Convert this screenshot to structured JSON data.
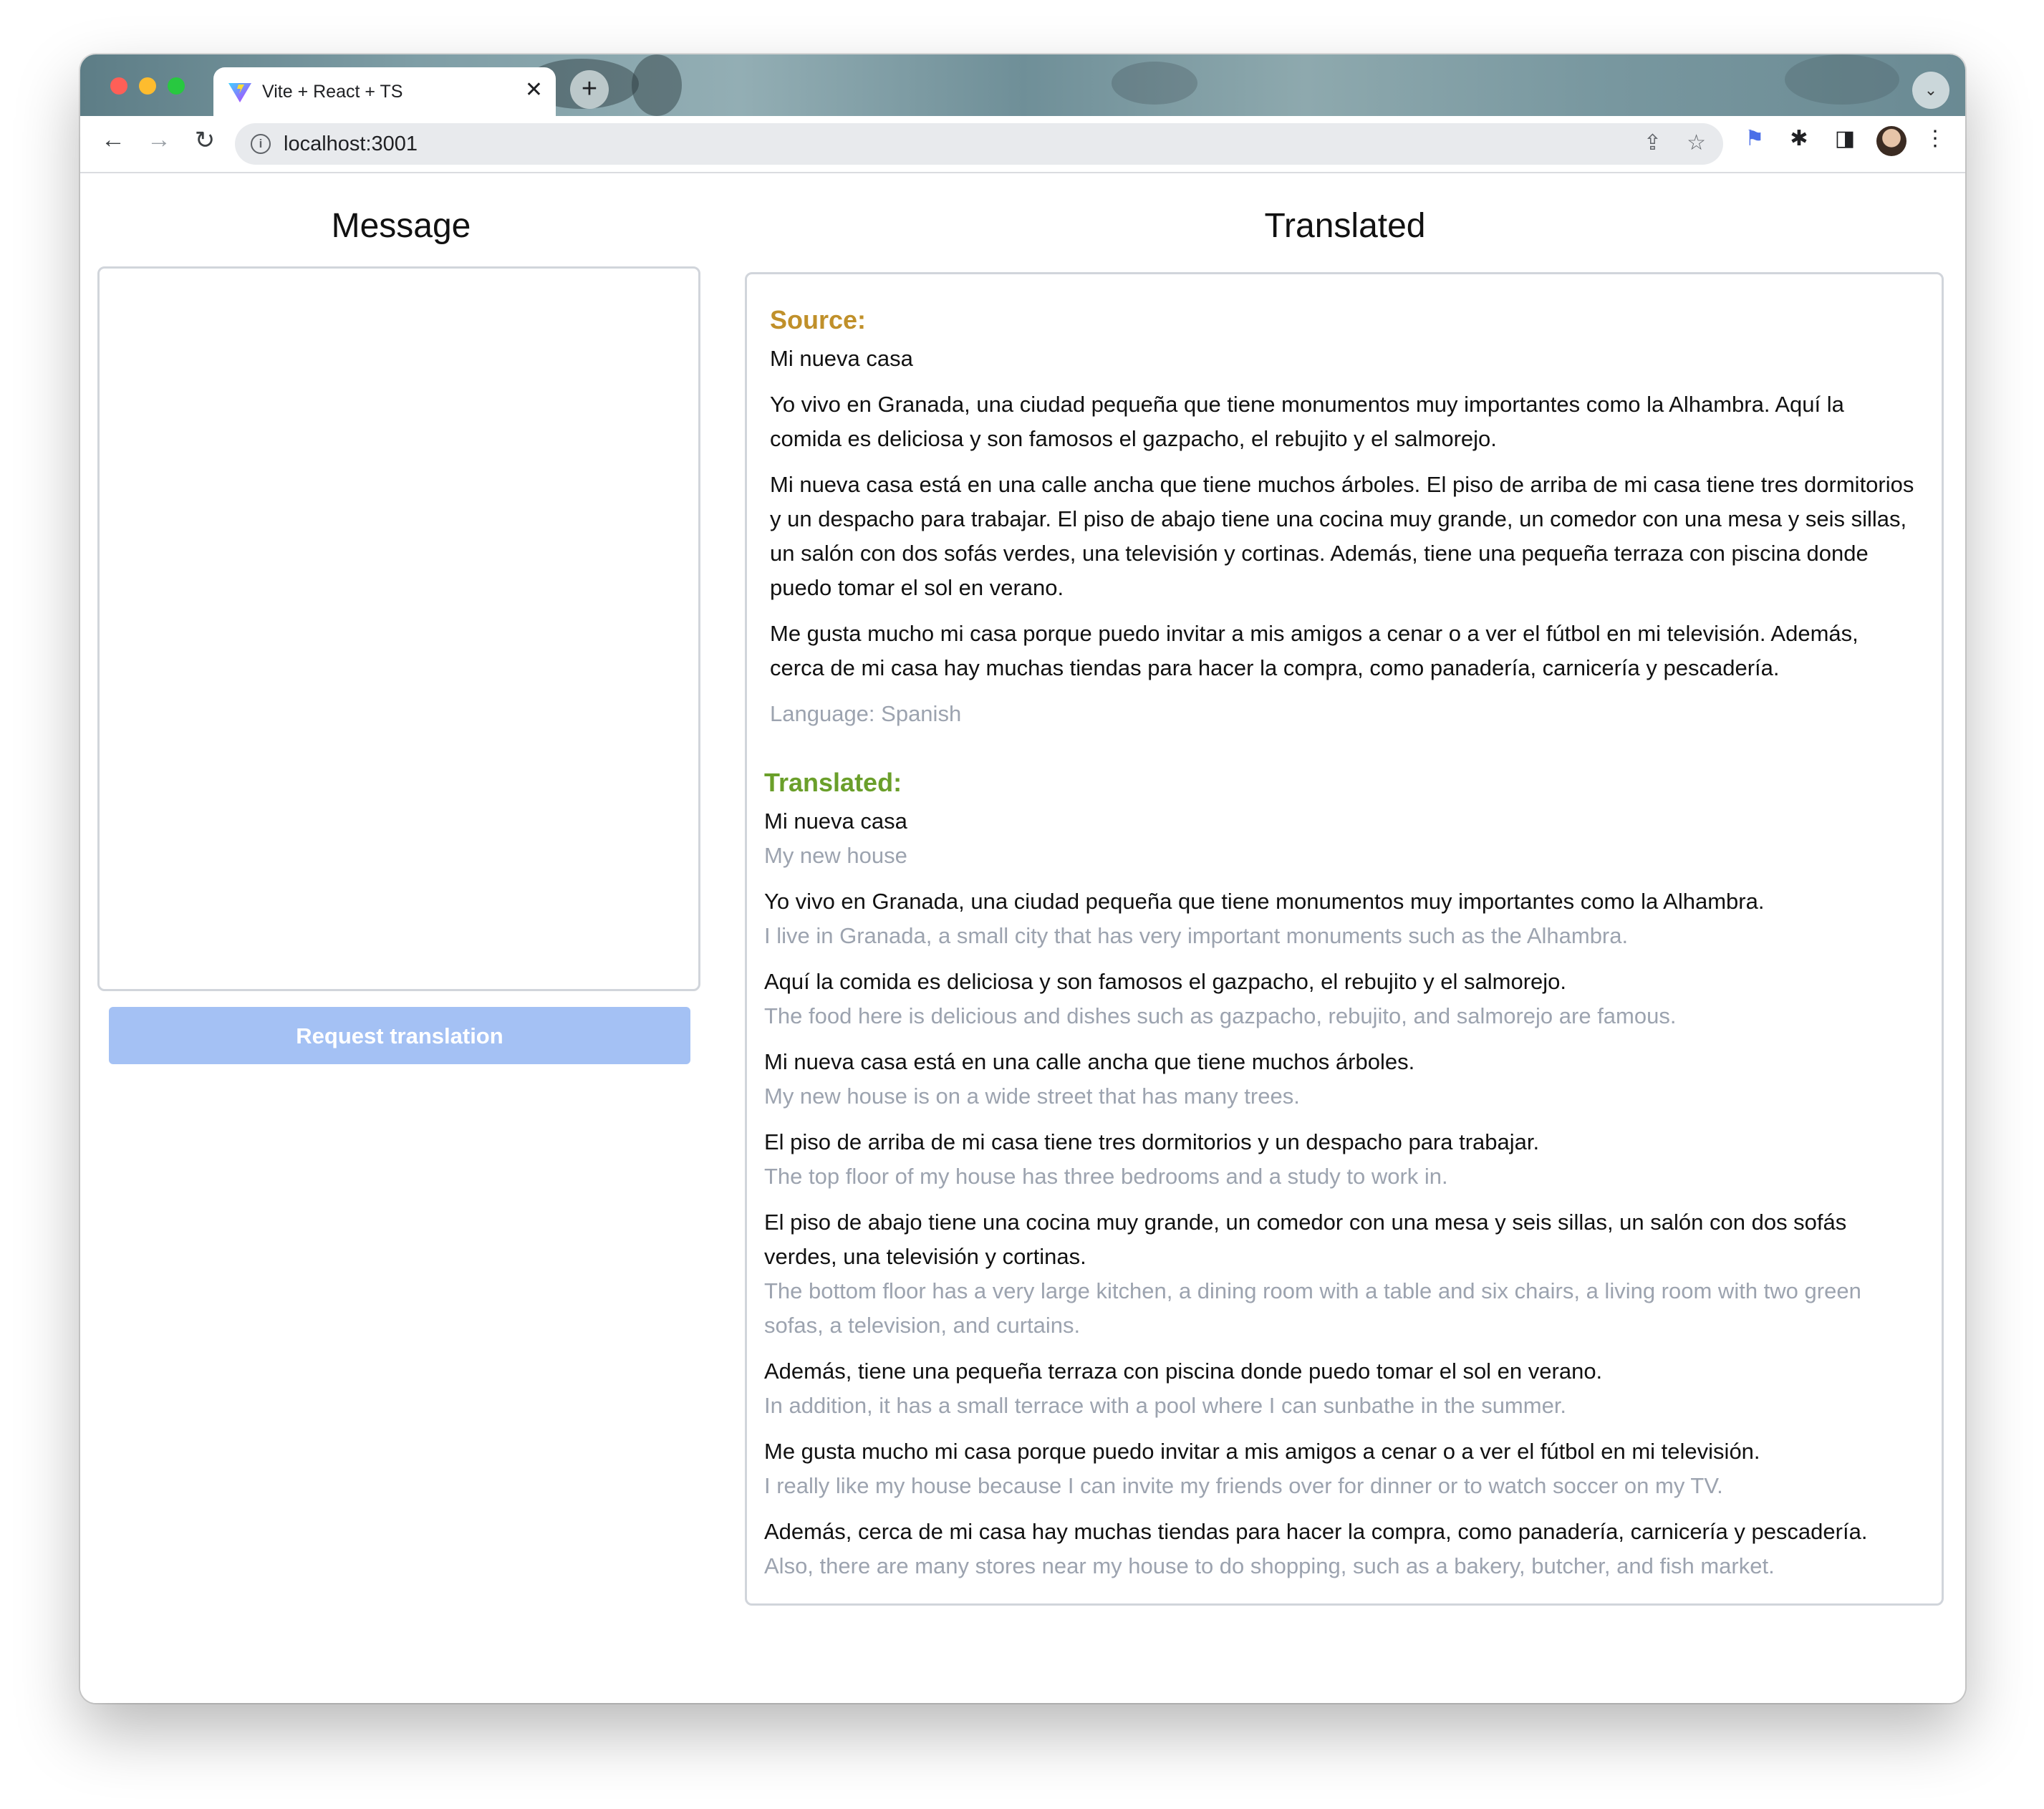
{
  "browser": {
    "tab_title": "Vite + React + TS",
    "url": "localhost:3001"
  },
  "left": {
    "heading": "Message",
    "message_value": "",
    "request_button": "Request translation"
  },
  "right": {
    "heading": "Translated",
    "source_label": "Source:",
    "source_paragraphs": [
      "Mi nueva casa",
      "Yo vivo en Granada, una ciudad pequeña que tiene monumentos muy importantes como la Alhambra. Aquí la comida es deliciosa y son famosos el gazpacho, el rebujito y el salmorejo.",
      "Mi nueva casa está en una calle ancha que tiene muchos árboles. El piso de arriba de mi casa tiene tres dormitorios y un despacho para trabajar. El piso de abajo tiene una cocina muy grande, un comedor con una mesa y seis sillas, un salón con dos sofás verdes, una televisión y cortinas. Además, tiene una pequeña terraza con piscina donde puedo tomar el sol en verano.",
      "Me gusta mucho mi casa porque puedo invitar a mis amigos a cenar o a ver el fútbol en mi televisión. Además, cerca de mi casa hay muchas tiendas para hacer la compra, como panadería, carnicería y pescadería."
    ],
    "language": "Language: Spanish",
    "translated_label": "Translated:",
    "pairs": [
      {
        "orig": "Mi nueva casa",
        "trans": "My new house"
      },
      {
        "orig": "Yo vivo en Granada, una ciudad pequeña que tiene monumentos muy importantes como la Alhambra.",
        "trans": "I live in Granada, a small city that has very important monuments such as the Alhambra."
      },
      {
        "orig": "Aquí la comida es deliciosa y son famosos el gazpacho, el rebujito y el salmorejo.",
        "trans": "The food here is delicious and dishes such as gazpacho, rebujito, and salmorejo are famous."
      },
      {
        "orig": "Mi nueva casa está en una calle ancha que tiene muchos árboles.",
        "trans": "My new house is on a wide street that has many trees."
      },
      {
        "orig": "El piso de arriba de mi casa tiene tres dormitorios y un despacho para trabajar.",
        "trans": "The top floor of my house has three bedrooms and a study to work in."
      },
      {
        "orig": "El piso de abajo tiene una cocina muy grande, un comedor con una mesa y seis sillas, un salón con dos sofás verdes, una televisión y cortinas.",
        "trans": "The bottom floor has a very large kitchen, a dining room with a table and six chairs, a living room with two green sofas, a television, and curtains."
      },
      {
        "orig": "Además, tiene una pequeña terraza con piscina donde puedo tomar el sol en verano.",
        "trans": "In addition, it has a small terrace with a pool where I can sunbathe in the summer."
      },
      {
        "orig": "Me gusta mucho mi casa porque puedo invitar a mis amigos a cenar o a ver el fútbol en mi televisión.",
        "trans": "I really like my house because I can invite my friends over for dinner or to watch soccer on my TV."
      },
      {
        "orig": "Además, cerca de mi casa hay muchas tiendas para hacer la compra, como panadería, carnicería y pescadería.",
        "trans": "Also, there are many stores near my house to do shopping, such as a bakery, butcher, and fish market."
      }
    ]
  },
  "colors": {
    "source_label": "#c0902a",
    "translated_label": "#6a9f2a",
    "button_bg": "#a4c1f4",
    "muted_text": "#9ca3af"
  },
  "icons": {
    "back": "arrow-left-icon",
    "forward": "arrow-right-icon",
    "reload": "reload-icon",
    "info": "info-icon",
    "share": "share-icon",
    "bookmark": "star-icon",
    "extension": "puzzle-icon",
    "side_panel": "side-panel-icon",
    "menu": "kebab-menu-icon"
  }
}
